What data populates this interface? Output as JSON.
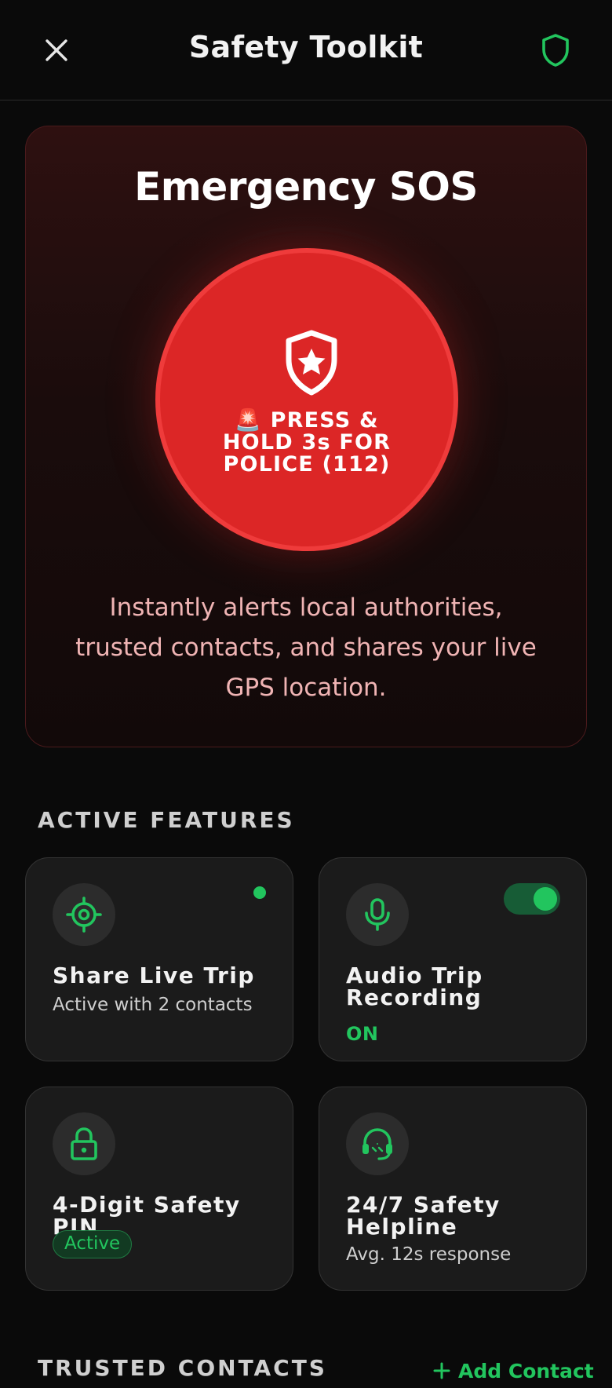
{
  "header": {
    "title": "Safety Toolkit",
    "close_icon": "close-icon",
    "shield_icon": "shield-icon",
    "accent_color": "#22c55e"
  },
  "sos": {
    "title": "Emergency SOS",
    "button_label": "🚨 PRESS & HOLD 3s FOR POLICE (112)",
    "description": "Instantly alerts local authorities, trusted contacts, and shares your live GPS location.",
    "button_color": "#dc2626",
    "icon": "shield-star-icon"
  },
  "active_features": {
    "heading": "ACTIVE FEATURES",
    "tiles": [
      {
        "title": "Share Live Trip",
        "subtitle": "Active with 2 contacts",
        "icon": "target-icon",
        "indicator": "live-dot"
      },
      {
        "title": "Audio Trip Recording",
        "status": "ON",
        "icon": "microphone-icon",
        "toggle_on": true
      },
      {
        "title": "4-Digit Safety PIN",
        "badge": "Active",
        "icon": "lock-icon"
      },
      {
        "title": "24/7 Safety Helpline",
        "subtitle": "Avg. 12s response",
        "icon": "headset-icon"
      }
    ]
  },
  "trusted_contacts": {
    "heading": "TRUSTED CONTACTS",
    "add_label": "Add Contact",
    "add_icon": "plus-icon"
  }
}
